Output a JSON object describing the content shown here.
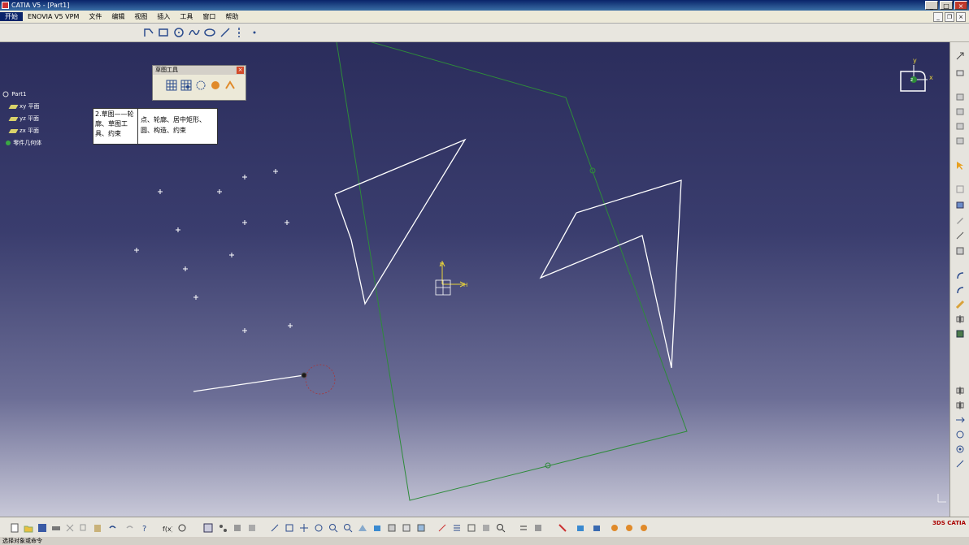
{
  "window": {
    "title": "CATIA V5 - [Part1]"
  },
  "menu": [
    "开始",
    "ENOVIA V5 VPM",
    "文件",
    "编辑",
    "视图",
    "插入",
    "工具",
    "窗口",
    "帮助"
  ],
  "tree": {
    "root": "Part1",
    "items": [
      "xy 平面",
      "yz 平面",
      "zx 平面",
      "零件几何体"
    ]
  },
  "sketch_tools_panel": {
    "title": "草图工具"
  },
  "notes": {
    "left": "2.草图——轮廓、草图工具、约束",
    "right": "点、轮廓、居中矩形、圆、构造、约束"
  },
  "compass": {
    "x": "x",
    "y": "y",
    "z": "z"
  },
  "origin": {
    "h": "H",
    "v": "V"
  },
  "status": "选择对象或命令",
  "colors": {
    "bg_top": "#2b2d5c",
    "bg_bottom": "#c8c8d8",
    "sketch_white": "#ffffff",
    "construction_green": "#2e8b3a",
    "axis_yellow": "#e8d23a"
  }
}
